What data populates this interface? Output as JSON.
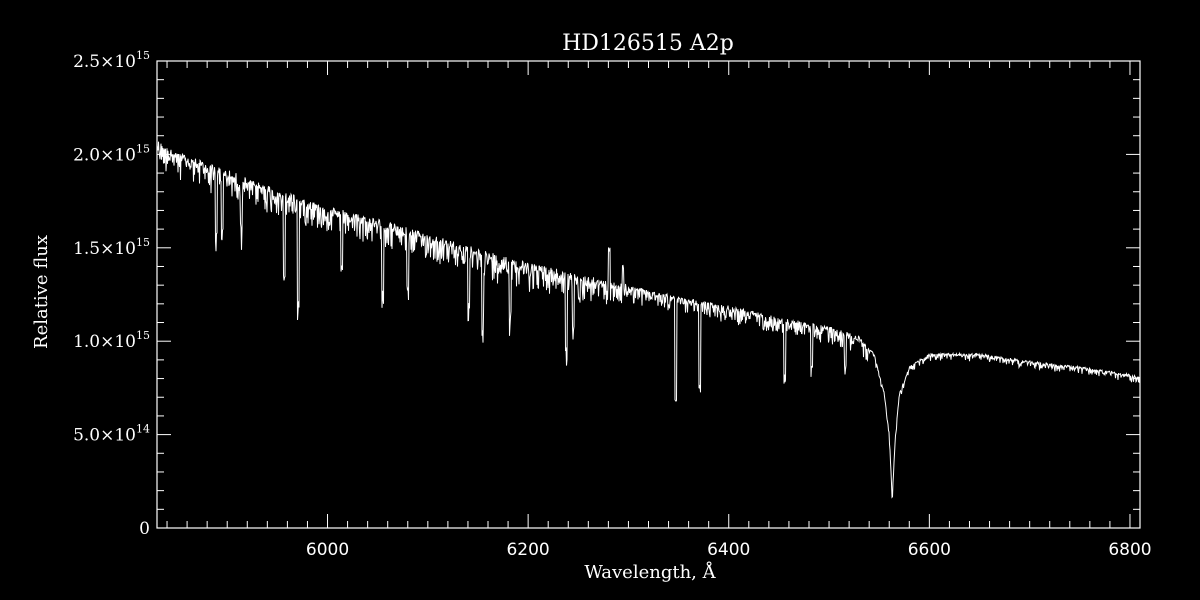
{
  "chart_data": {
    "type": "line",
    "title": "HD126515  A2p",
    "xlabel": "Wavelength, Å",
    "ylabel": "Relative flux",
    "xlim": [
      5830,
      6810
    ],
    "ylim": [
      0,
      2500000000000000.0
    ],
    "grid": false,
    "x_ticks": [
      {
        "value": 6000,
        "label": "6000"
      },
      {
        "value": 6200,
        "label": "6200"
      },
      {
        "value": 6400,
        "label": "6400"
      },
      {
        "value": 6600,
        "label": "6600"
      },
      {
        "value": 6800,
        "label": "6800"
      }
    ],
    "y_ticks": [
      {
        "value": 0,
        "mantissa": "0",
        "exp": ""
      },
      {
        "value": 500000000000000.0,
        "mantissa": "5.0×10",
        "exp": "14"
      },
      {
        "value": 1000000000000000.0,
        "mantissa": "1.0×10",
        "exp": "15"
      },
      {
        "value": 1500000000000000.0,
        "mantissa": "1.5×10",
        "exp": "15"
      },
      {
        "value": 2000000000000000.0,
        "mantissa": "2.0×10",
        "exp": "15"
      },
      {
        "value": 2500000000000000.0,
        "mantissa": "2.5×10",
        "exp": "15"
      }
    ],
    "series": [
      {
        "color": "#ffffff",
        "x": [
          5830,
          5850,
          5900,
          5950,
          6000,
          6050,
          6100,
          6150,
          6200,
          6250,
          6300,
          6350,
          6400,
          6450,
          6500,
          6530,
          6545,
          6555,
          6560,
          6563,
          6566,
          6570,
          6580,
          6600,
          6650,
          6700,
          6750,
          6810
        ],
        "y": [
          2060000000000000.0,
          2000000000000000.0,
          1900000000000000.0,
          1800000000000000.0,
          1710000000000000.0,
          1640000000000000.0,
          1560000000000000.0,
          1480000000000000.0,
          1410000000000000.0,
          1340000000000000.0,
          1290000000000000.0,
          1230000000000000.0,
          1180000000000000.0,
          1120000000000000.0,
          1070000000000000.0,
          1020000000000000.0,
          930000000000000.0,
          720000000000000.0,
          500000000000000.0,
          170000000000000.0,
          480000000000000.0,
          720000000000000.0,
          860000000000000.0,
          930000000000000.0,
          930000000000000.0,
          890000000000000.0,
          860000000000000.0,
          810000000000000.0
        ]
      }
    ],
    "absorption_lines": [
      {
        "x": 5889,
        "depth": 350000000000000.0
      },
      {
        "x": 5895,
        "depth": 300000000000000.0
      },
      {
        "x": 5914,
        "depth": 250000000000000.0
      },
      {
        "x": 5957,
        "depth": 450000000000000.0
      },
      {
        "x": 5971,
        "depth": 550000000000000.0
      },
      {
        "x": 6014,
        "depth": 300000000000000.0
      },
      {
        "x": 6055,
        "depth": 350000000000000.0
      },
      {
        "x": 6080,
        "depth": 300000000000000.0
      },
      {
        "x": 6141,
        "depth": 300000000000000.0
      },
      {
        "x": 6155,
        "depth": 350000000000000.0
      },
      {
        "x": 6182,
        "depth": 280000000000000.0
      },
      {
        "x": 6238,
        "depth": 400000000000000.0
      },
      {
        "x": 6245,
        "depth": 250000000000000.0
      },
      {
        "x": 6347,
        "depth": 550000000000000.0
      },
      {
        "x": 6371,
        "depth": 450000000000000.0
      },
      {
        "x": 6456,
        "depth": 300000000000000.0
      },
      {
        "x": 6483,
        "depth": 220000000000000.0
      },
      {
        "x": 6516,
        "depth": 180000000000000.0
      }
    ],
    "emission_spikes": [
      {
        "x": 6281,
        "height": 200000000000000.0
      },
      {
        "x": 6295,
        "height": 100000000000000.0
      }
    ]
  }
}
